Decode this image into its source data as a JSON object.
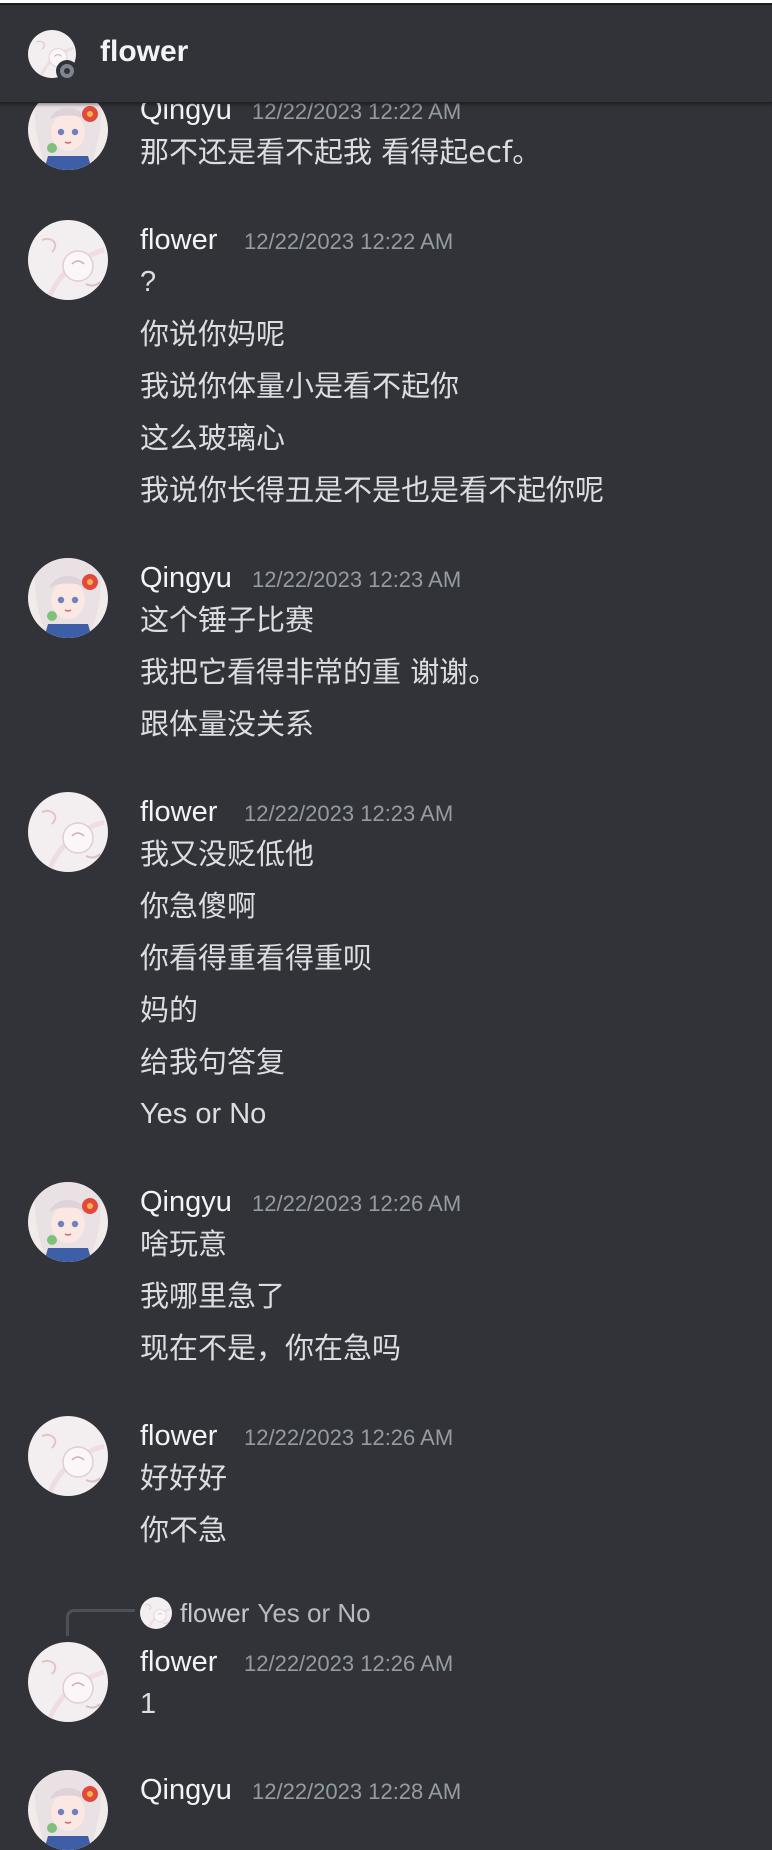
{
  "channel": {
    "title": "flower"
  },
  "messages": [
    {
      "user": "Qingyu",
      "timestamp": "12/22/2023 12:22 AM",
      "lines": [
        "那不还是看不起我 看得起ecf。"
      ]
    },
    {
      "user": "flower",
      "timestamp": "12/22/2023 12:22 AM",
      "lines": [
        "?",
        "你说你妈呢",
        "我说你体量小是看不起你",
        "这么玻璃心",
        "我说你长得丑是不是也是看不起你呢"
      ]
    },
    {
      "user": "Qingyu",
      "timestamp": "12/22/2023 12:23 AM",
      "lines": [
        "这个锤子比赛",
        "我把它看得非常的重 谢谢。",
        "跟体量没关系"
      ]
    },
    {
      "user": "flower",
      "timestamp": "12/22/2023 12:23 AM",
      "lines": [
        "我又没贬低他",
        "你急傻啊",
        "你看得重看得重呗",
        "妈的",
        "给我句答复",
        "Yes or No"
      ]
    },
    {
      "user": "Qingyu",
      "timestamp": "12/22/2023 12:26 AM",
      "lines": [
        "啥玩意",
        "我哪里急了",
        "现在不是，你在急吗"
      ]
    },
    {
      "user": "flower",
      "timestamp": "12/22/2023 12:26 AM",
      "lines": [
        "好好好",
        "你不急"
      ]
    },
    {
      "user": "flower",
      "timestamp": "12/22/2023 12:26 AM",
      "lines": [
        "1"
      ],
      "reply": {
        "user": "flower",
        "text": "Yes or No"
      }
    },
    {
      "user": "Qingyu",
      "timestamp": "12/22/2023 12:28 AM",
      "lines": []
    }
  ]
}
